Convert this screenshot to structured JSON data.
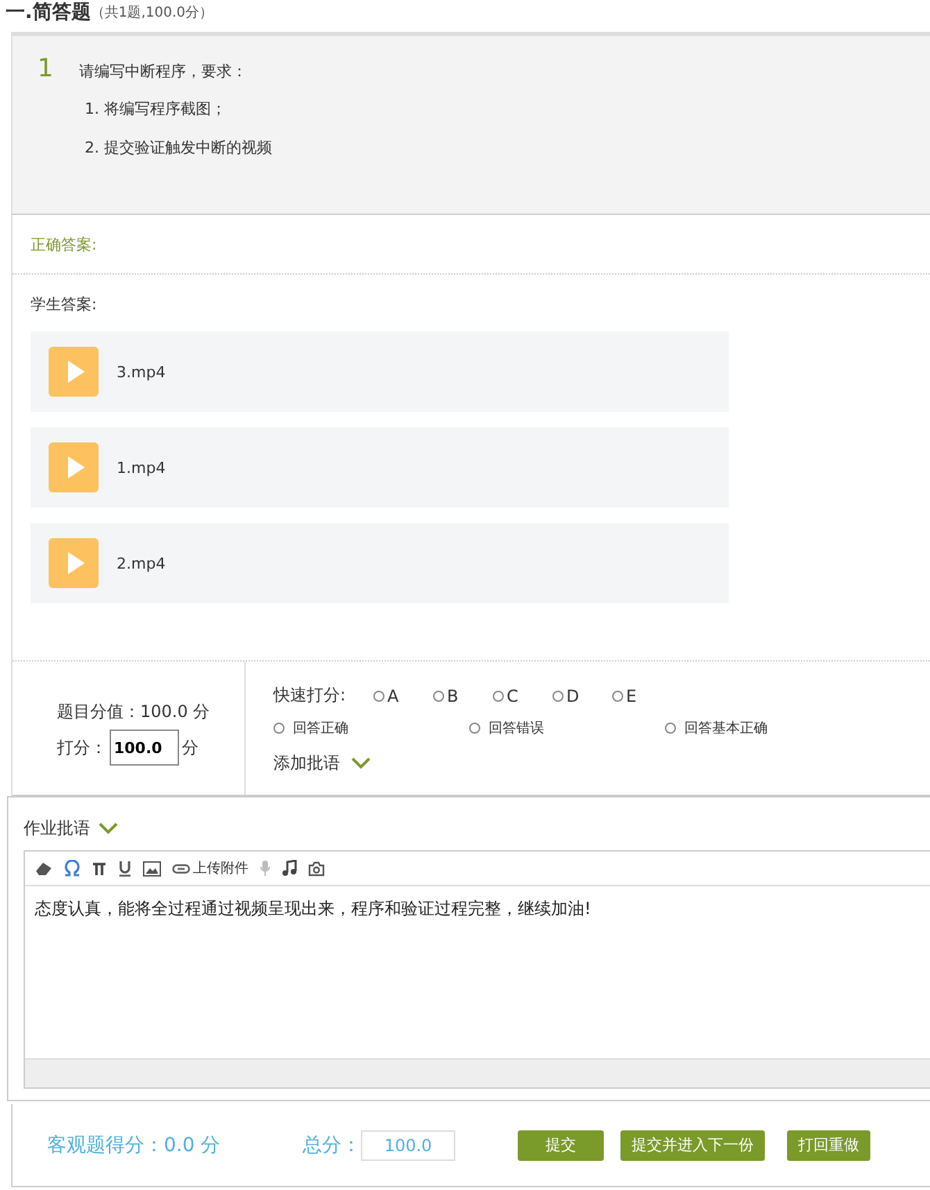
{
  "section": {
    "title": "一.简答题",
    "summary": "（共1题,100.0分）"
  },
  "question": {
    "number": "1",
    "prompt": "请编写中断程序，要求：",
    "requirements": [
      "1. 将编写程序截图；",
      "2. 提交验证触发中断的视频"
    ]
  },
  "correct_answer": {
    "label": "正确答案:"
  },
  "student_answer": {
    "label": "学生答案:",
    "files": [
      {
        "name": "3.mp4",
        "kind": "video"
      },
      {
        "name": "1.mp4",
        "kind": "video"
      },
      {
        "name": "2.mp4",
        "kind": "video"
      }
    ]
  },
  "scoring": {
    "value_label": "题目分值：100.0 分",
    "score_label": "打分：",
    "score_value": "100.0",
    "score_unit": "分",
    "quick_label": "快速打分:",
    "grades": [
      {
        "label": "A",
        "selected": false
      },
      {
        "label": "B",
        "selected": false
      },
      {
        "label": "C",
        "selected": false
      },
      {
        "label": "D",
        "selected": false
      },
      {
        "label": "E",
        "selected": false
      }
    ],
    "remarks": [
      {
        "label": "回答正确",
        "selected": false
      },
      {
        "label": "回答错误",
        "selected": false
      },
      {
        "label": "回答基本正确",
        "selected": false
      }
    ],
    "add_comment": "添加批语"
  },
  "comment": {
    "label": "作业批语",
    "toolbar": [
      {
        "kind": "eraser"
      },
      {
        "kind": "omega"
      },
      {
        "kind": "pi"
      },
      {
        "kind": "underline"
      },
      {
        "kind": "image"
      },
      {
        "kind": "attach",
        "label": "上传附件"
      },
      {
        "kind": "mic"
      },
      {
        "kind": "music"
      },
      {
        "kind": "camera"
      }
    ],
    "text": "态度认真，能将全过程通过视频呈现出来，程序和验证过程完整，继续加油!"
  },
  "footer": {
    "objective": "客观题得分：0.0 分",
    "total_label": "总分：",
    "total_value": "100.0",
    "buttons": [
      "提交",
      "提交并进入下一份",
      "打回重做"
    ]
  }
}
